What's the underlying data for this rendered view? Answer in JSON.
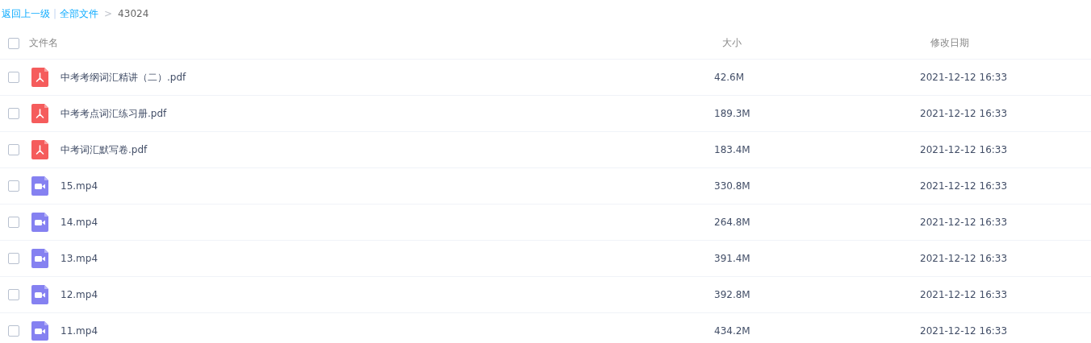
{
  "breadcrumb": {
    "links": [
      "返回上一级",
      "全部文件"
    ],
    "separator": "|",
    "arrow": ">",
    "current": "43024"
  },
  "table": {
    "select_all": {
      "checked": false
    },
    "columns": [
      "文件名",
      "大小",
      "修改日期"
    ],
    "rows": [
      {
        "kind": "pdf",
        "name": "中考考纲词汇精讲（二）.pdf",
        "size": "42.6M",
        "date": "2021-12-12 16:33",
        "checked": false
      },
      {
        "kind": "pdf",
        "name": "中考考点词汇练习册.pdf",
        "size": "189.3M",
        "date": "2021-12-12 16:33",
        "checked": false
      },
      {
        "kind": "pdf",
        "name": "中考词汇默写卷.pdf",
        "size": "183.4M",
        "date": "2021-12-12 16:33",
        "checked": false
      },
      {
        "kind": "video",
        "name": "15.mp4",
        "size": "330.8M",
        "date": "2021-12-12 16:33",
        "checked": false
      },
      {
        "kind": "video",
        "name": "14.mp4",
        "size": "264.8M",
        "date": "2021-12-12 16:33",
        "checked": false
      },
      {
        "kind": "video",
        "name": "13.mp4",
        "size": "391.4M",
        "date": "2021-12-12 16:33",
        "checked": false
      },
      {
        "kind": "video",
        "name": "12.mp4",
        "size": "392.8M",
        "date": "2021-12-12 16:33",
        "checked": false
      },
      {
        "kind": "video",
        "name": "11.mp4",
        "size": "434.2M",
        "date": "2021-12-12 16:33",
        "checked": false
      }
    ]
  }
}
